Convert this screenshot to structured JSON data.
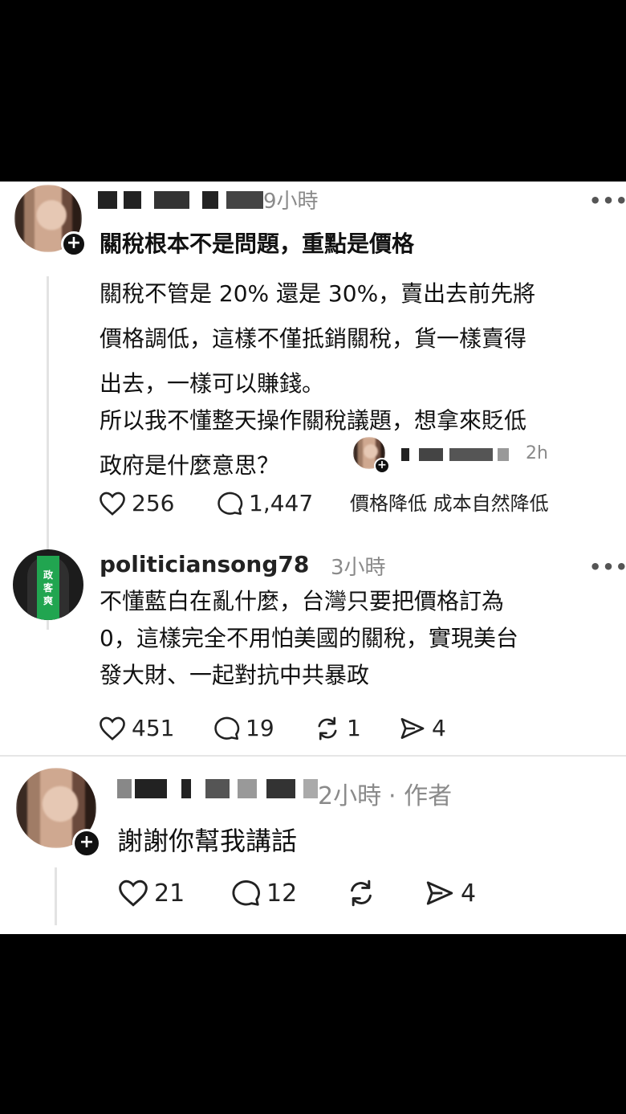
{
  "post1": {
    "time": "9小時",
    "title": "關稅根本不是問題，重點是價格",
    "para1": [
      "關稅不管是 20% 還是 30%，賣出去前先將",
      "價格調低，這樣不僅抵銷關稅，貨一樣賣得",
      "出去，一樣可以賺錢。"
    ],
    "para2": [
      "所以我不懂整天操作關稅議題，想拿來貶低",
      "政府是什麼意思？"
    ],
    "likes": "256",
    "comments": "1,447",
    "inline_reply": {
      "time": "2h",
      "text": "價格降低 成本自然降低"
    }
  },
  "post2": {
    "username": "politiciansong78",
    "time": "3小時",
    "avatar_text": [
      "政",
      "客",
      "爽"
    ],
    "lines": [
      "不懂藍白在亂什麼，台灣只要把價格訂為",
      "0，這樣完全不用怕美國的關稅，實現美台",
      "發大財、一起對抗中共暴政"
    ],
    "likes": "451",
    "comments": "19",
    "reposts": "1",
    "shares": "4"
  },
  "post3": {
    "time": "2小時",
    "author_tag": "· 作者",
    "text": "謝謝你幫我講話",
    "likes": "21",
    "comments": "12",
    "shares": "4"
  },
  "icons": {
    "more": "more-icon",
    "like": "heart-icon",
    "comment": "comment-icon",
    "repost": "repost-icon",
    "share": "share-icon"
  }
}
